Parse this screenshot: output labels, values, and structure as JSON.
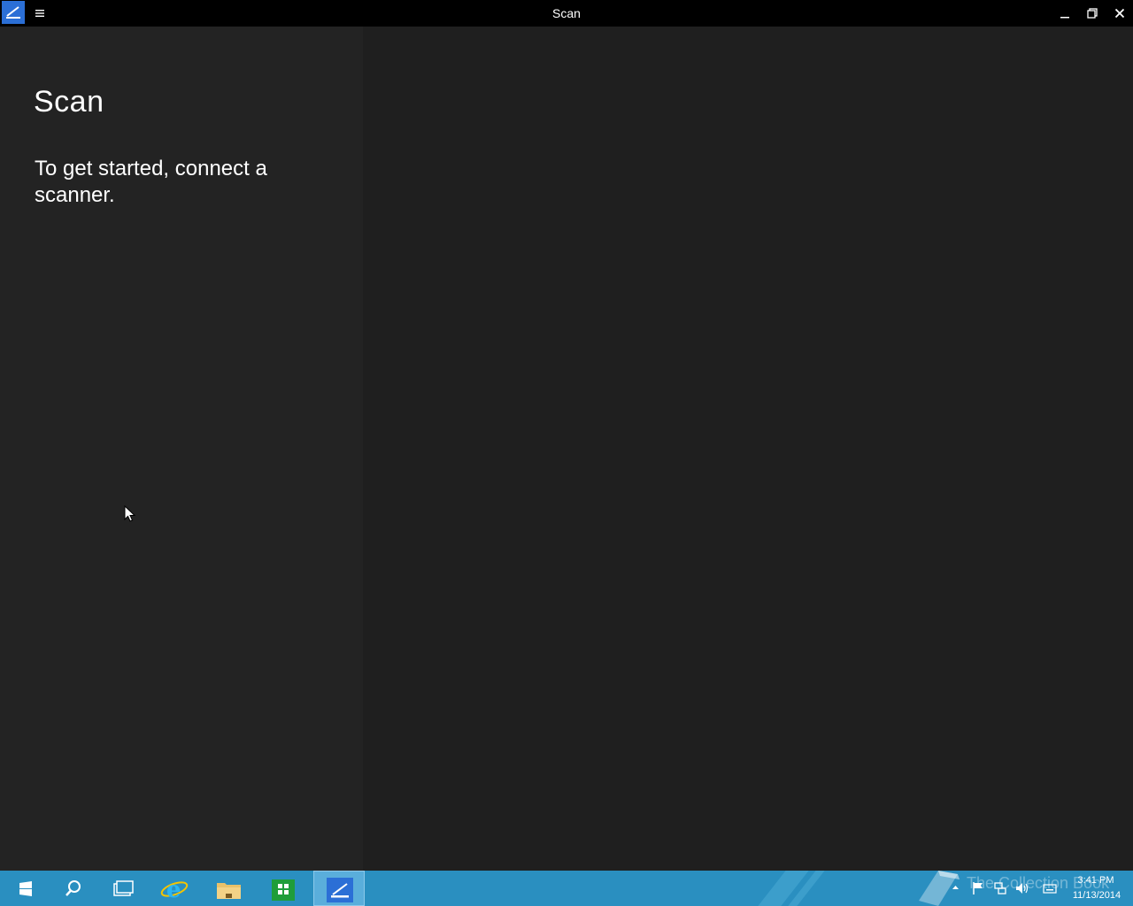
{
  "window": {
    "title": "Scan"
  },
  "left_pane": {
    "heading": "Scan",
    "message": "To get started, connect a scanner."
  },
  "taskbar": {
    "items": [
      {
        "name": "start",
        "icon": "windows-logo-icon"
      },
      {
        "name": "search",
        "icon": "search-icon"
      },
      {
        "name": "task-view",
        "icon": "task-view-icon"
      },
      {
        "name": "internet-explorer",
        "icon": "internet-explorer-icon"
      },
      {
        "name": "file-explorer",
        "icon": "folder-icon"
      },
      {
        "name": "store",
        "icon": "store-icon"
      },
      {
        "name": "scan",
        "icon": "scanner-icon",
        "active": true
      }
    ],
    "watermark": "The Collection Book",
    "clock": {
      "time": "3:41 PM",
      "date": "11/13/2014"
    }
  },
  "colors": {
    "titlebar": "#000000",
    "left_pane": "#232323",
    "right_pane": "#1f1f1f",
    "taskbar": "#2a8fc0",
    "accent": "#2b6fd6"
  }
}
